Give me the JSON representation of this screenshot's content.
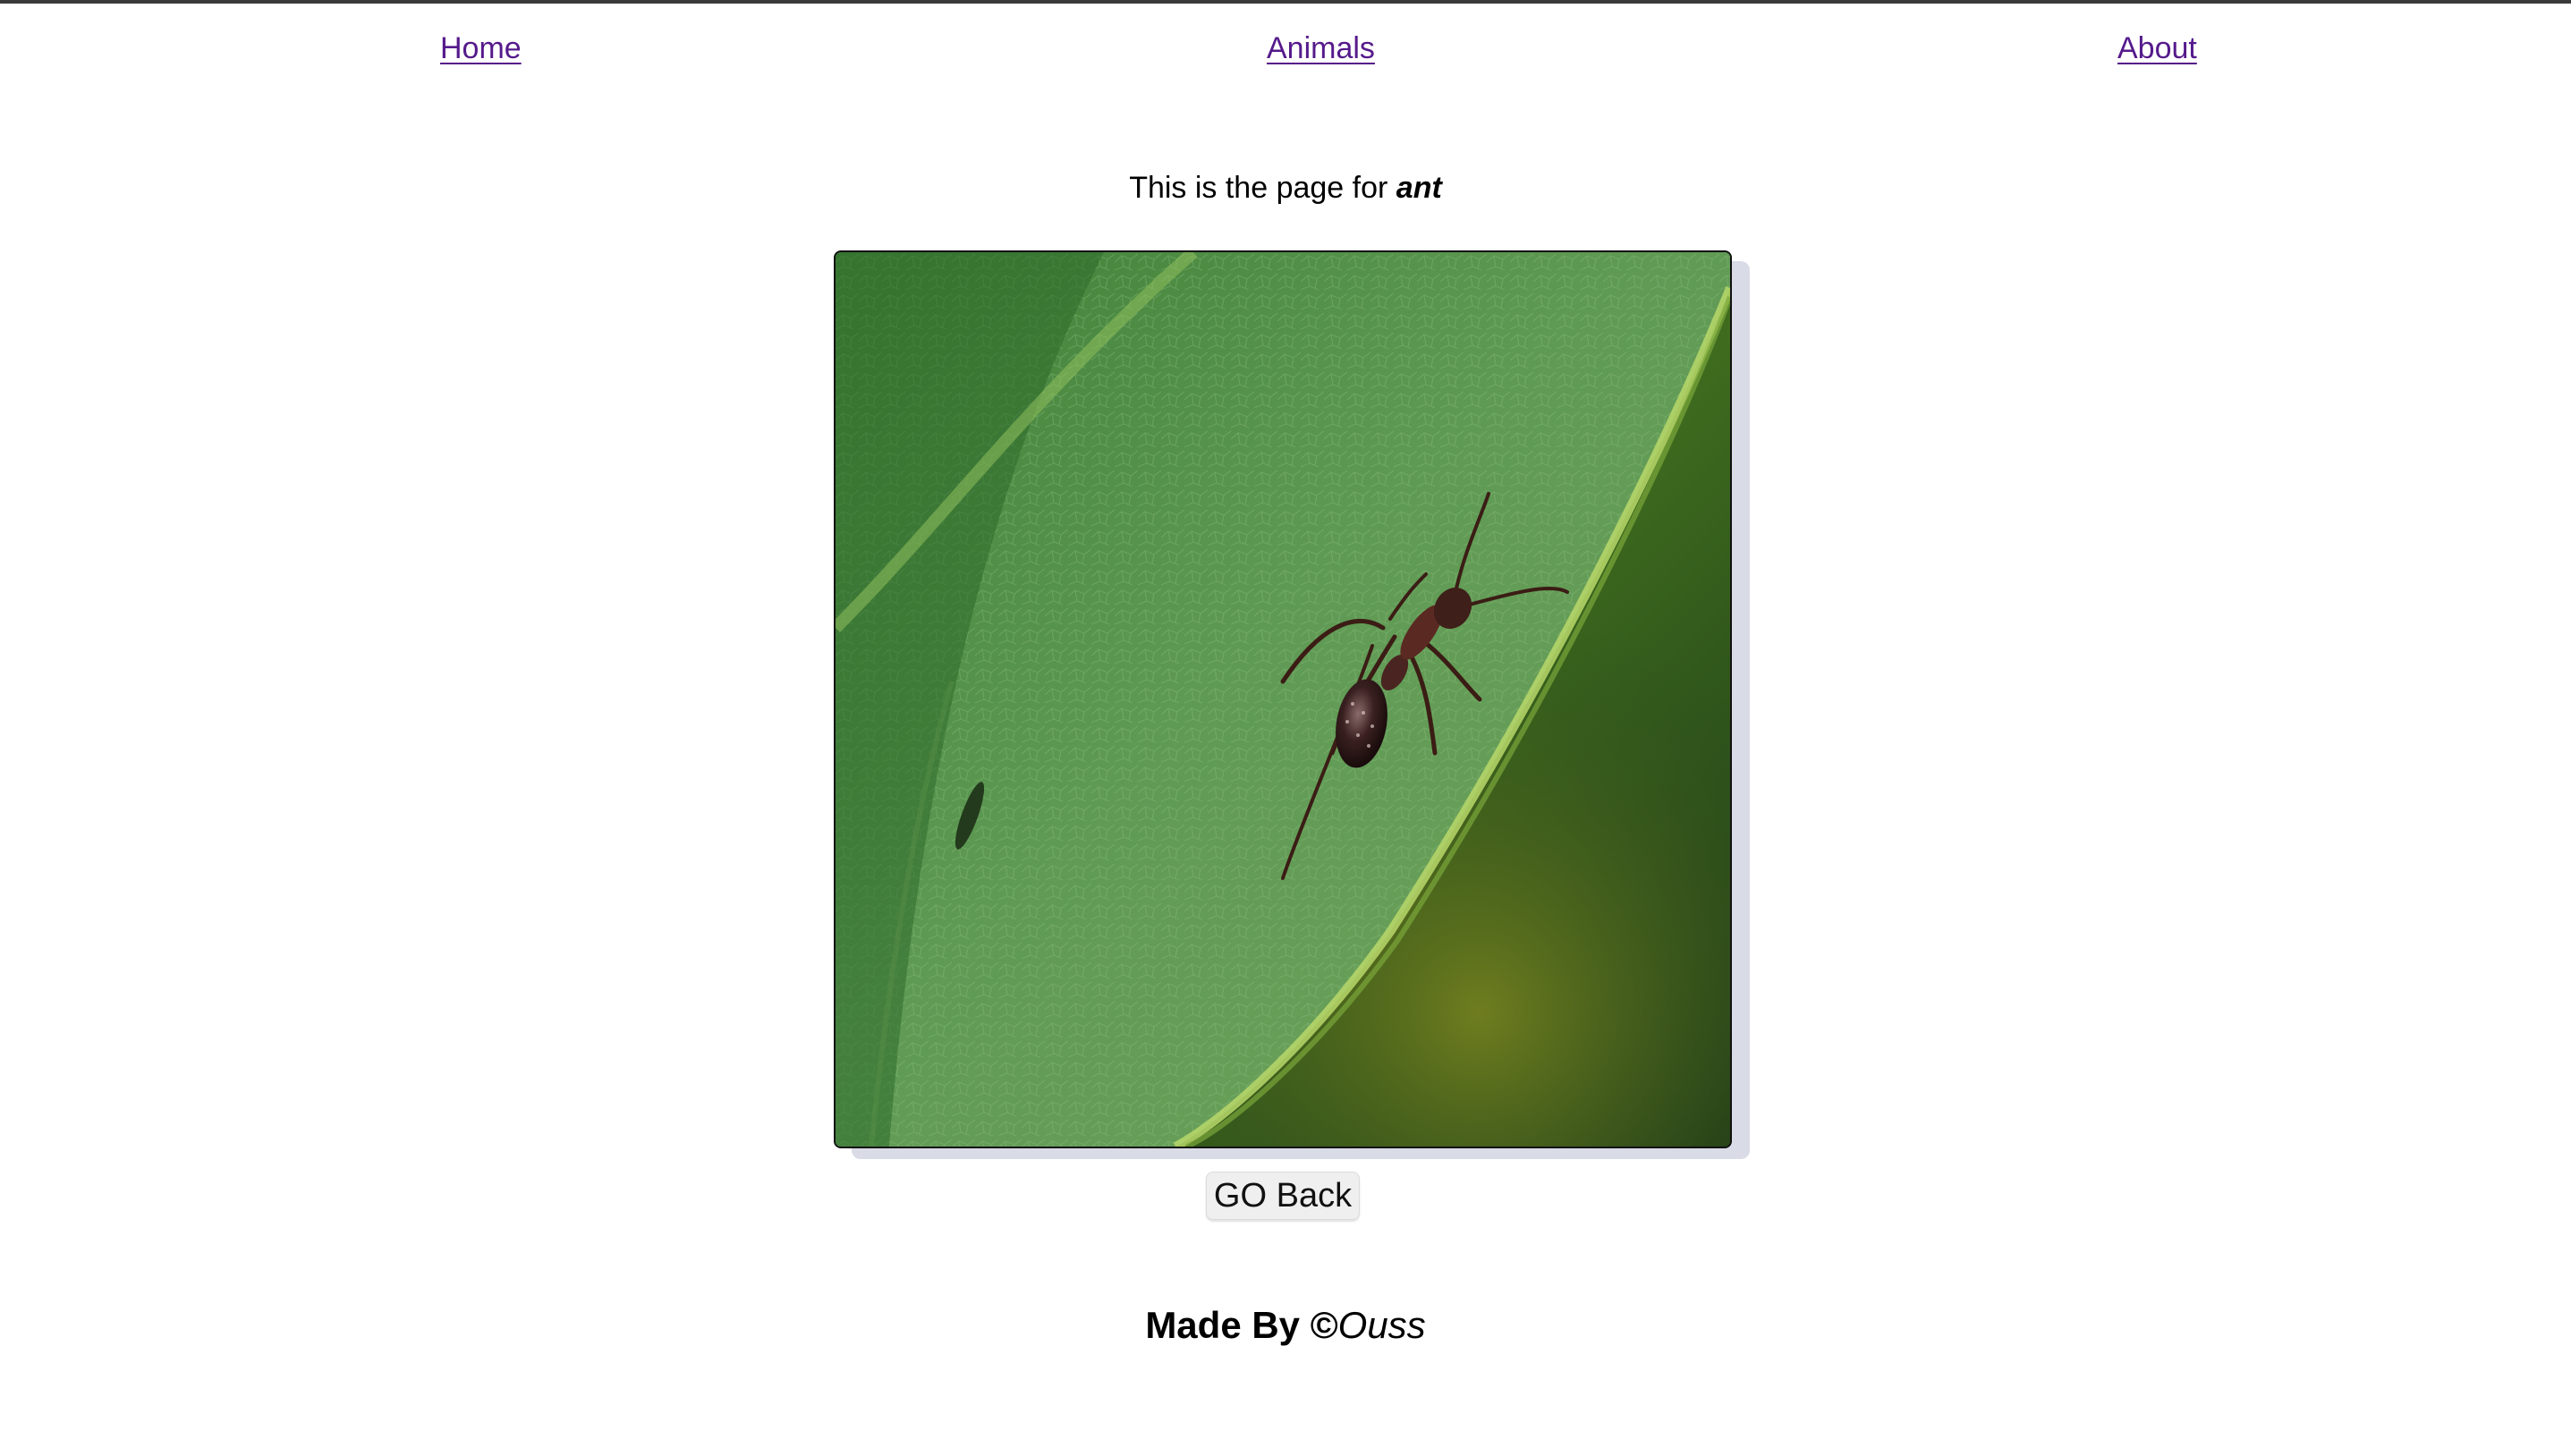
{
  "nav": {
    "home": "Home",
    "animals": "Animals",
    "about": "About"
  },
  "intro": {
    "prefix": "This is the page for ",
    "animal": "ant"
  },
  "photo": {
    "subject": "ant on green leaf"
  },
  "buttons": {
    "go_back": "GO Back"
  },
  "footer": {
    "prefix": "Made By ",
    "copyright_symbol": "©",
    "author": "Ouss"
  },
  "colors": {
    "link": "#551a8b",
    "top_bar": "#3a3a3a",
    "leaf_green": "#4f8f3e",
    "background_green": "#2e4a1c"
  }
}
